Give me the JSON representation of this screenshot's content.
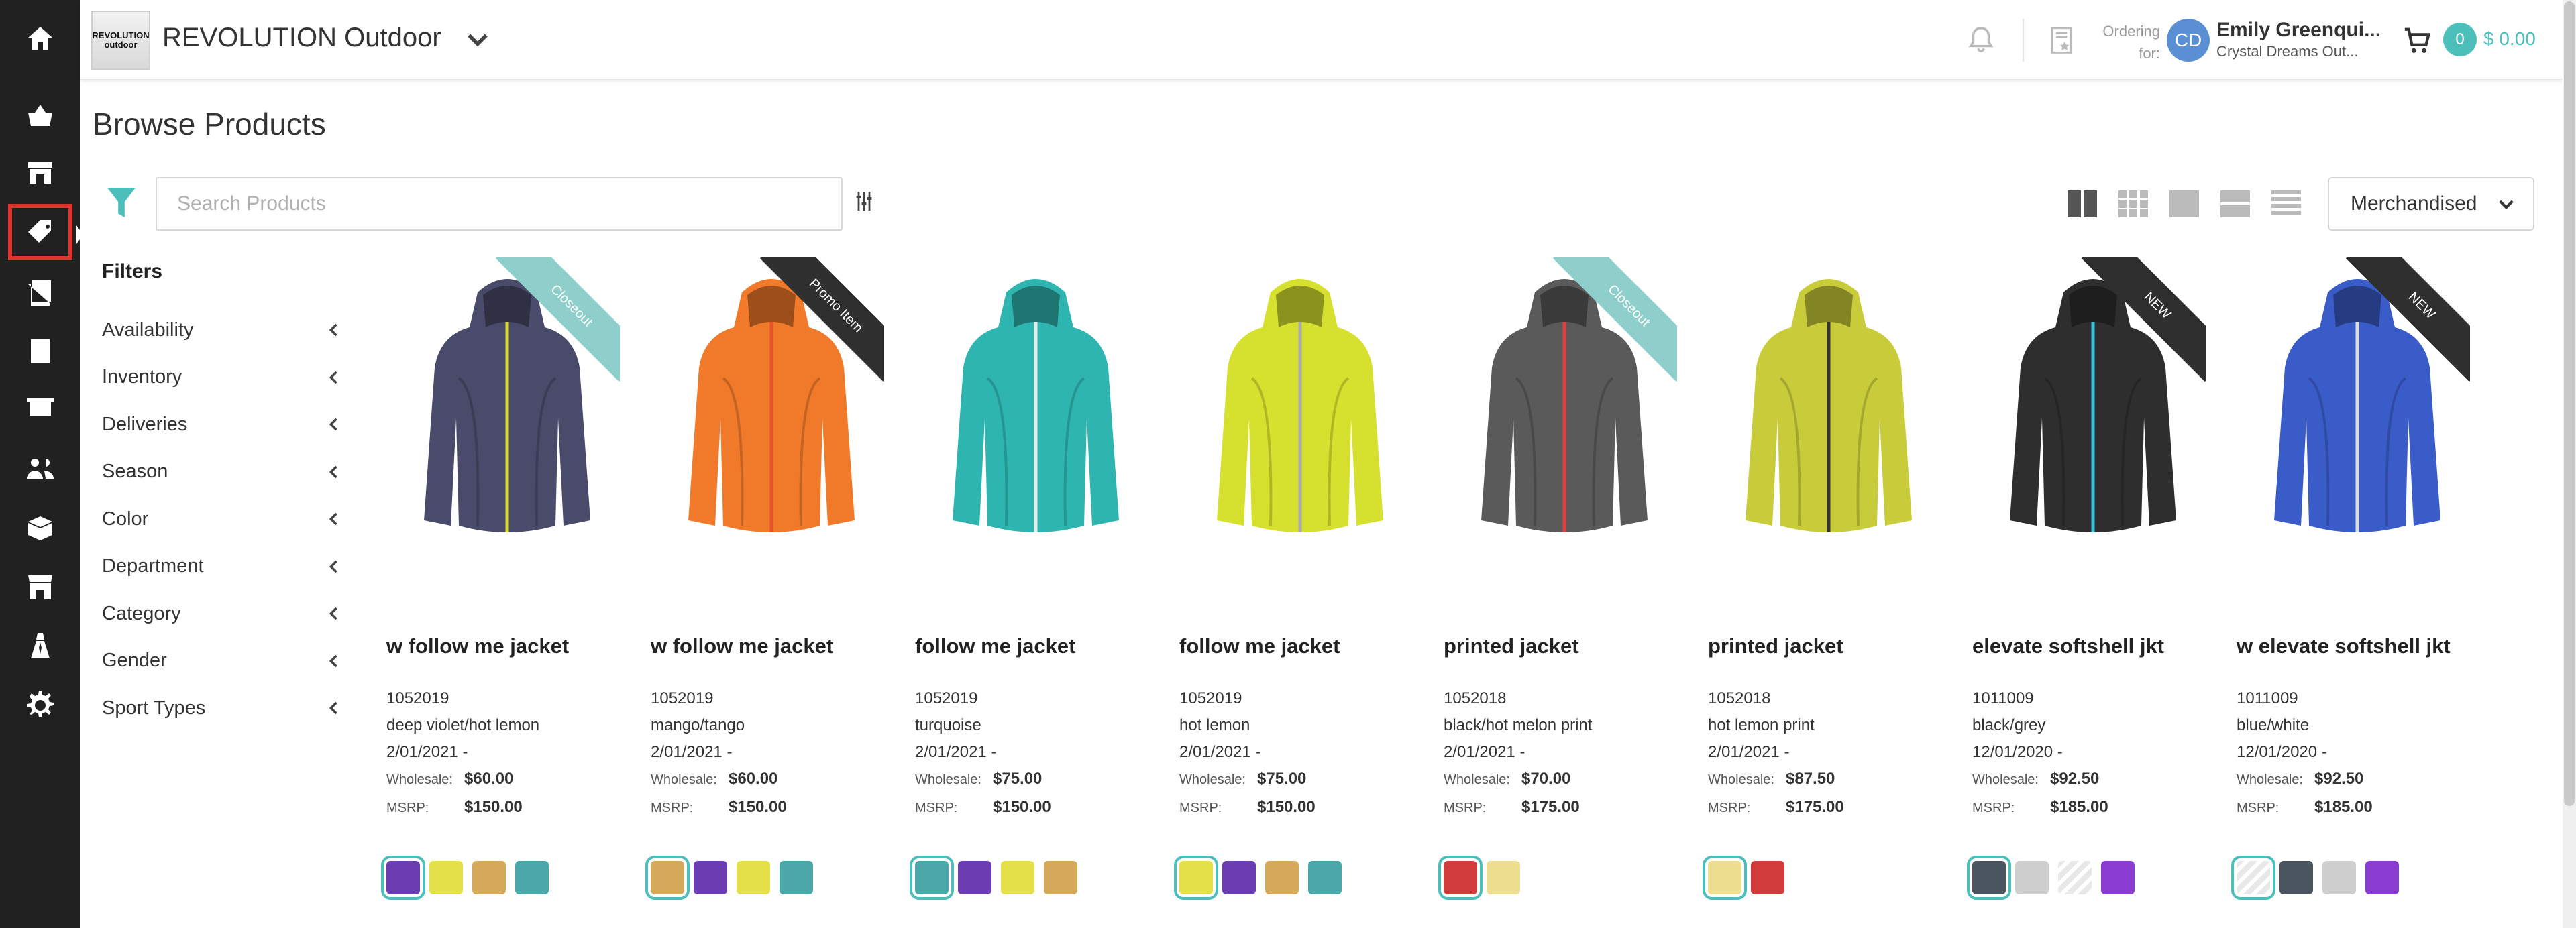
{
  "app": {
    "logo_line1": "REVOLUTION",
    "logo_line2": "outdoor",
    "brand": "REVOLUTION Outdoor"
  },
  "nav_icons": [
    "home-icon",
    "basket-icon",
    "store-icon",
    "tag-icon",
    "catalog-icon",
    "orders-icon",
    "presentation-icon",
    "customers-icon",
    "products-icon",
    "storefront-icon",
    "sales-rep-icon",
    "settings-icon"
  ],
  "header": {
    "ordering_for_label_1": "Ordering",
    "ordering_for_label_2": "for:",
    "avatar_initials": "CD",
    "user_name": "Emily Greenqui...",
    "user_org": "Crystal Dreams Out...",
    "cart_count": "0",
    "cart_total": "$ 0.00"
  },
  "page": {
    "title": "Browse Products",
    "search_placeholder": "Search Products",
    "sort_label": "Merchandised"
  },
  "filters": {
    "title": "Filters",
    "items": [
      "Availability",
      "Inventory",
      "Deliveries",
      "Season",
      "Color",
      "Department",
      "Category",
      "Gender",
      "Sport Types"
    ]
  },
  "price_labels": {
    "wholesale": "Wholesale:",
    "msrp": "MSRP:"
  },
  "colors": {
    "accent": "#4cbfbb",
    "closeout": "#8fcfcb",
    "promo": "#2f2f2f",
    "new": "#2f2f2f",
    "rail": "#212121",
    "active": "#e0312d"
  },
  "products": [
    {
      "name": "w follow me jacket",
      "style": "1052019",
      "color": "deep violet/hot lemon",
      "date": "2/01/2021 -",
      "wholesale": "$60.00",
      "msrp": "$150.00",
      "ribbon": "Closeout",
      "jacket": "#4a4a6a",
      "zip": "#d7dc3c",
      "swatches": [
        "#6a3db3",
        "#e4e04a",
        "#d4a95a",
        "#4aa8a8"
      ]
    },
    {
      "name": "w follow me jacket",
      "style": "1052019",
      "color": "mango/tango",
      "date": "2/01/2021 -",
      "wholesale": "$60.00",
      "msrp": "$150.00",
      "ribbon": "Promo Item",
      "jacket": "#f07a2a",
      "zip": "#e85030",
      "swatches": [
        "#d4a95a",
        "#6a3db3",
        "#e4e04a",
        "#4aa8a8"
      ]
    },
    {
      "name": "follow me jacket",
      "style": "1052019",
      "color": "turquoise",
      "date": "2/01/2021 -",
      "wholesale": "$75.00",
      "msrp": "$150.00",
      "ribbon": "",
      "jacket": "#2fb5b0",
      "zip": "#e8e8e8",
      "swatches": [
        "#4aa8a8",
        "#6a3db3",
        "#e4e04a",
        "#d4a95a"
      ]
    },
    {
      "name": "follow me jacket",
      "style": "1052019",
      "color": "hot lemon",
      "date": "2/01/2021 -",
      "wholesale": "$75.00",
      "msrp": "$150.00",
      "ribbon": "",
      "jacket": "#d6e02e",
      "zip": "#aaaaaa",
      "swatches": [
        "#e4e04a",
        "#6a3db3",
        "#d4a95a",
        "#4aa8a8"
      ]
    },
    {
      "name": "printed jacket",
      "style": "1052018",
      "color": "black/hot melon print",
      "date": "2/01/2021 -",
      "wholesale": "$70.00",
      "msrp": "$175.00",
      "ribbon": "Closeout",
      "jacket": "#5a5a5a",
      "zip": "#e04040",
      "swatches": [
        "#d23b3b",
        "#eddf8f"
      ]
    },
    {
      "name": "printed jacket",
      "style": "1052018",
      "color": "hot lemon print",
      "date": "2/01/2021 -",
      "wholesale": "$87.50",
      "msrp": "$175.00",
      "ribbon": "",
      "jacket": "#c9cc3a",
      "zip": "#333333",
      "swatches": [
        "#eddf8f",
        "#d23b3b"
      ]
    },
    {
      "name": "elevate softshell jkt",
      "style": "1011009",
      "color": "black/grey",
      "date": "12/01/2020 -",
      "wholesale": "$92.50",
      "msrp": "$185.00",
      "ribbon": "NEW",
      "jacket": "#2e2e2e",
      "zip": "#39c1e0",
      "swatches": [
        "#4a5560",
        "#cfcfcf",
        "striped",
        "#8a3cd0"
      ]
    },
    {
      "name": "w elevate softshell jkt",
      "style": "1011009",
      "color": "blue/white",
      "date": "12/01/2020 -",
      "wholesale": "$92.50",
      "msrp": "$185.00",
      "ribbon": "NEW",
      "jacket": "#3a5cc8",
      "zip": "#dddddd",
      "swatches": [
        "striped",
        "#4a5560",
        "#cfcfcf",
        "#8a3cd0"
      ]
    }
  ]
}
